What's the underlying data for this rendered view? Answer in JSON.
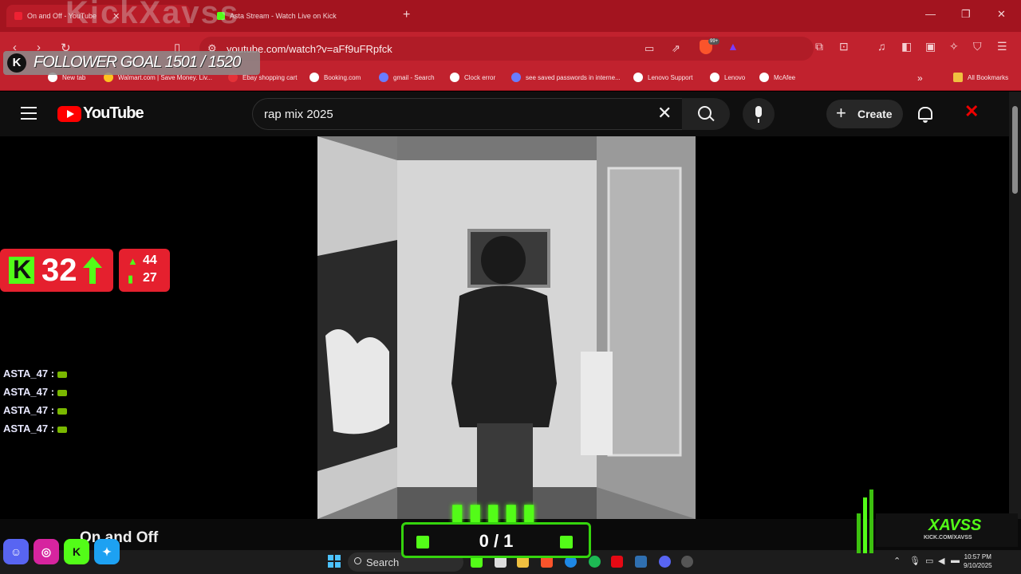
{
  "browser": {
    "tabs": [
      {
        "title": "On and Off - YouTube"
      },
      {
        "title": "Asta Stream - Watch Live on Kick"
      }
    ],
    "url": "youtube.com/watch?v=aFf9uFRpfck",
    "bookmarks": [
      "New tab",
      "Walmart.com | Save Money. Liv...",
      "Ebay shopping cart",
      "Booking.com",
      "gmail - Search",
      "Clock error",
      "see saved passwords in interne...",
      "Lenovo Support",
      "Lenovo",
      "McAfee"
    ],
    "all_bookmarks_label": "All Bookmarks",
    "extension_badge": "99+"
  },
  "overlay": {
    "follower_goal": "FOLLOWER GOAL 1501 / 1520",
    "watermark": "KickXavss",
    "kick_viewers": "32",
    "stat_up": "44",
    "stat_bars": "27",
    "chat": [
      {
        "user": "ASTA_47",
        "sep": ":"
      },
      {
        "user": "ASTA_47",
        "sep": ":"
      },
      {
        "user": "ASTA_47",
        "sep": ":"
      },
      {
        "user": "ASTA_47",
        "sep": ":"
      }
    ],
    "goal_count": "0 / 1",
    "streamer_name": "XAVSS",
    "streamer_url": "KICK.COM/XAVSS",
    "accent_color": "#53fc18",
    "panel_color": "#e5202e"
  },
  "youtube": {
    "logo_text": "YouTube",
    "search_query": "rap mix 2025",
    "create_label": "Create",
    "video_title": "On and Off"
  },
  "taskbar": {
    "search_label": "Search",
    "time": "10:57 PM",
    "date": "9/10/2025"
  }
}
